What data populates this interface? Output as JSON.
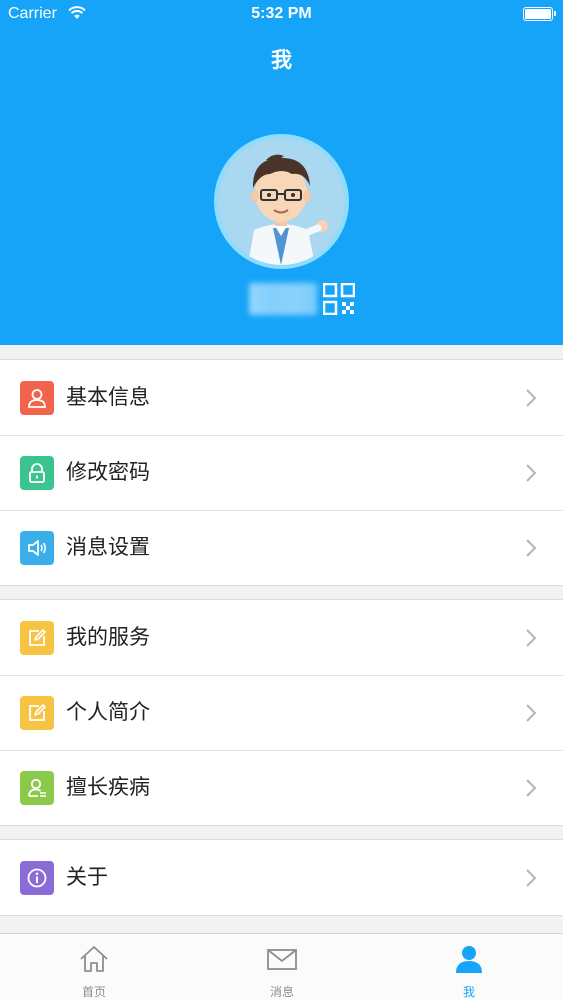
{
  "status_bar": {
    "carrier": "Carrier",
    "time": "5:32 PM"
  },
  "header": {
    "title": "我",
    "background_color": "#16a4f8"
  },
  "menu": {
    "groups": [
      [
        {
          "label": "基本信息",
          "icon": "user-icon",
          "color": "#f2634b"
        },
        {
          "label": "修改密码",
          "icon": "lock-icon",
          "color": "#3cc490"
        },
        {
          "label": "消息设置",
          "icon": "speaker-icon",
          "color": "#3aaee8"
        }
      ],
      [
        {
          "label": "我的服务",
          "icon": "edit-icon",
          "color": "#f6c342"
        },
        {
          "label": "个人简介",
          "icon": "edit-icon",
          "color": "#f6c342"
        },
        {
          "label": "擅长疾病",
          "icon": "expertise-icon",
          "color": "#8bc94a"
        }
      ],
      [
        {
          "label": "关于",
          "icon": "info-icon",
          "color": "#8b6bd6"
        }
      ]
    ]
  },
  "tabbar": {
    "tabs": [
      {
        "label": "首页",
        "icon": "home-icon",
        "active": false
      },
      {
        "label": "消息",
        "icon": "mail-icon",
        "active": false
      },
      {
        "label": "我",
        "icon": "person-icon",
        "active": true
      }
    ],
    "active_color": "#16a4f8",
    "inactive_color": "#8e8e8e"
  }
}
